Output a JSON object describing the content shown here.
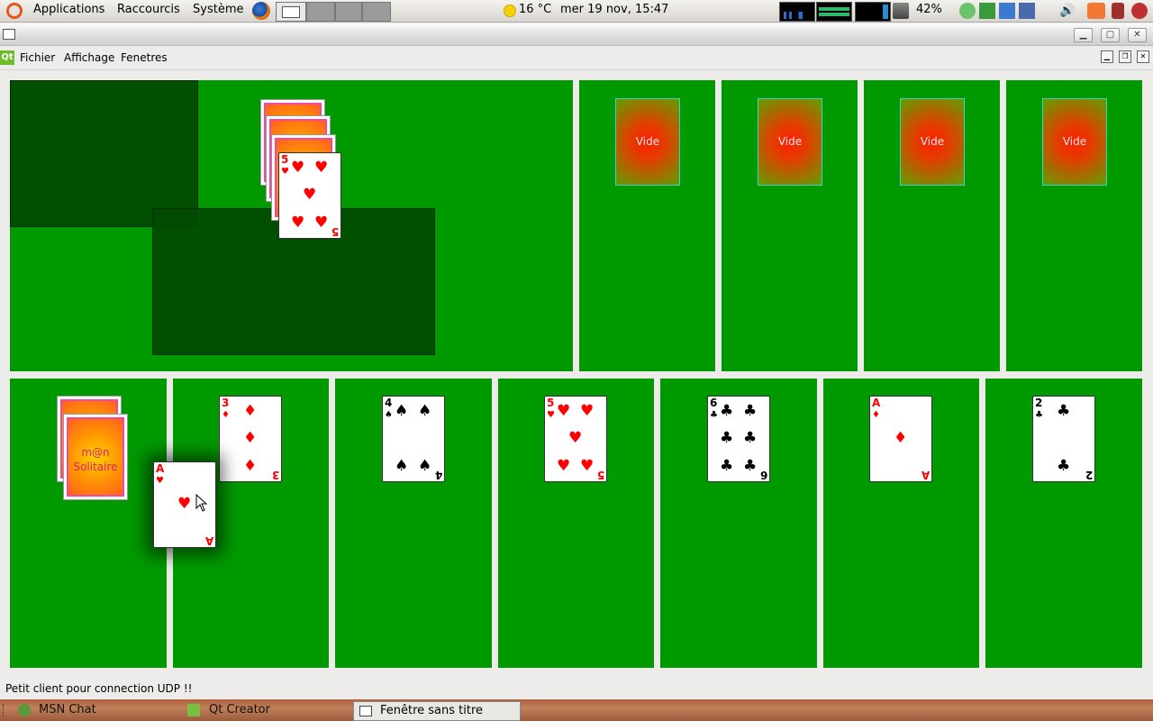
{
  "top_panel": {
    "menus": [
      "Applications",
      "Raccourcis",
      "Système"
    ],
    "weather": "16 °C",
    "clock": "mer 19 nov, 15:47",
    "battery": "42%"
  },
  "menubar": {
    "logo": "Qt",
    "items": [
      "Fichier",
      "Affichage",
      "Fenetres"
    ]
  },
  "foundations": {
    "empty_label": "Vide"
  },
  "stock": {
    "back_text_1": "m@n",
    "back_text_2": "Solitaire"
  },
  "waste": {
    "top_rank": "5",
    "top_suit": "♥"
  },
  "tableau": [
    {
      "rank": "A",
      "suit": "♥"
    },
    {
      "rank": "3",
      "suit": "♦"
    },
    {
      "rank": "4",
      "suit": "♠"
    },
    {
      "rank": "5",
      "suit": "♥"
    },
    {
      "rank": "6",
      "suit": "♣"
    },
    {
      "rank": "A",
      "suit": "♦"
    },
    {
      "rank": "2",
      "suit": "♣"
    }
  ],
  "dragged_card": {
    "rank": "A",
    "suit": "♥"
  },
  "status": "Petit client pour connection UDP !!",
  "taskbar": {
    "items": [
      "MSN Chat",
      "Qt Creator",
      "Fenêtre sans titre"
    ]
  },
  "colors": {
    "felt": "#009a00",
    "drop_zone": "#004b00",
    "red_suit": "#ff0000"
  }
}
